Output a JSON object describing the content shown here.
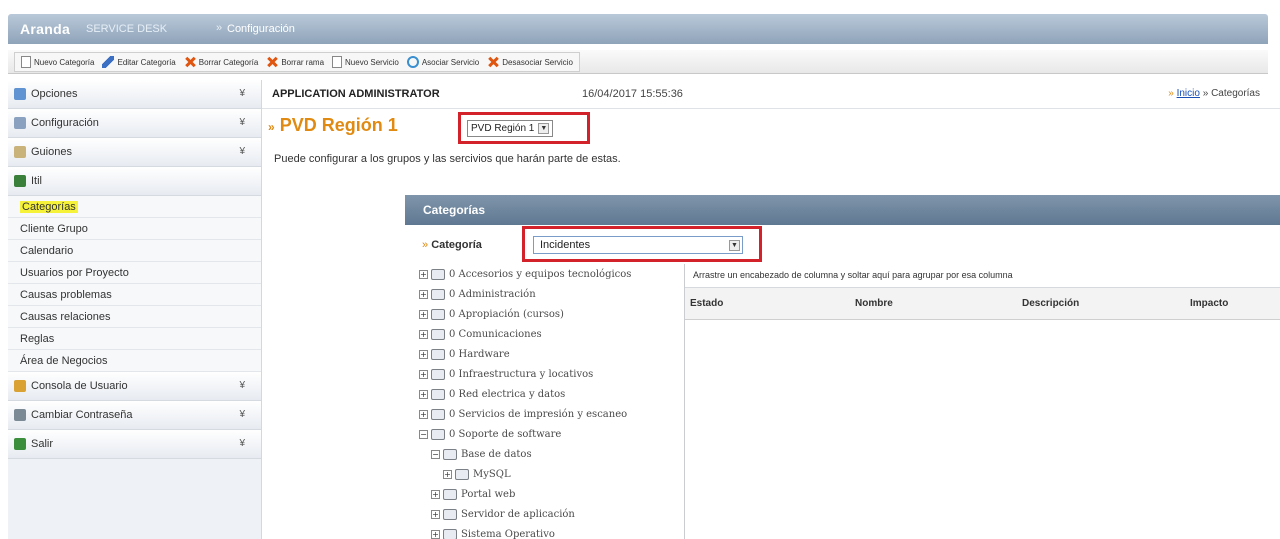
{
  "header": {
    "brand": "Aranda",
    "brand_sub": "SERVICE DESK",
    "separator": "»",
    "section": "Configuración"
  },
  "toolbar": {
    "buttons": [
      {
        "label": "Nuevo Categoría",
        "icon": "document-icon"
      },
      {
        "label": "Editar Categoría",
        "icon": "pencil-icon"
      },
      {
        "label": "Borrar Categoría",
        "icon": "delete-icon"
      },
      {
        "label": "Borrar rama",
        "icon": "delete-icon"
      },
      {
        "label": "Nuevo Servicio",
        "icon": "document-icon"
      },
      {
        "label": "Asociar Servicio",
        "icon": "link-icon"
      },
      {
        "label": "Desasociar Servicio",
        "icon": "delete-icon"
      }
    ]
  },
  "sidebar": {
    "sections_top": [
      {
        "label": "Opciones",
        "chevron": "¥"
      },
      {
        "label": "Configuración",
        "chevron": "¥"
      },
      {
        "label": "Guiones",
        "chevron": "¥"
      },
      {
        "label": "Itil",
        "chevron": ""
      }
    ],
    "items": [
      {
        "label": "Categorías",
        "highlight": true
      },
      {
        "label": "Cliente Grupo"
      },
      {
        "label": "Calendario"
      },
      {
        "label": "Usuarios por Proyecto"
      },
      {
        "label": "Causas problemas"
      },
      {
        "label": "Causas relaciones"
      },
      {
        "label": "Reglas"
      },
      {
        "label": "Área de Negocios"
      }
    ],
    "sections_bottom": [
      {
        "label": "Consola de Usuario",
        "chevron": "¥"
      },
      {
        "label": "Cambiar Contraseña",
        "chevron": "¥"
      },
      {
        "label": "Salir",
        "chevron": "¥"
      }
    ]
  },
  "infobar": {
    "user": "APPLICATION ADMINISTRATOR",
    "datetime": "16/04/2017 15:55:36",
    "crumb_marker": "»",
    "crumb_home": "Inicio",
    "crumb_sep": "»",
    "crumb_current": "Categorías"
  },
  "region": {
    "bullet": "»",
    "title": "PVD Región 1",
    "selected": "PVD Región 1"
  },
  "description": "Puede configurar a los grupos y las sercivios que harán parte de estas.",
  "categories": {
    "header": "Categorías",
    "label_bullet": "»",
    "label": "Categoría",
    "selected": "Incidentes",
    "tree": [
      {
        "label": "0 Accesorios y equipos tecnológicos",
        "level": 0,
        "expander": "+"
      },
      {
        "label": "0 Administración",
        "level": 0,
        "expander": "+"
      },
      {
        "label": "0 Apropiación (cursos)",
        "level": 0,
        "expander": "+"
      },
      {
        "label": "0 Comunicaciones",
        "level": 0,
        "expander": "+"
      },
      {
        "label": "0 Hardware",
        "level": 0,
        "expander": "+"
      },
      {
        "label": "0 Infraestructura y locativos",
        "level": 0,
        "expander": "+"
      },
      {
        "label": "0 Red electrica y datos",
        "level": 0,
        "expander": "+"
      },
      {
        "label": "0 Servicios de impresión y escaneo",
        "level": 0,
        "expander": "+"
      },
      {
        "label": "0 Soporte de software",
        "level": 0,
        "expander": "−"
      },
      {
        "label": "Base de datos",
        "level": 1,
        "expander": "−"
      },
      {
        "label": "MySQL",
        "level": 2,
        "expander": "+"
      },
      {
        "label": "Portal web",
        "level": 1,
        "expander": "+"
      },
      {
        "label": "Servidor de aplicación",
        "level": 1,
        "expander": "+"
      },
      {
        "label": "Sistema Operativo",
        "level": 1,
        "expander": "+"
      }
    ],
    "group_hint": "Arrastre un encabezado de columna y soltar aquí para agrupar por esa columna",
    "columns": [
      "Estado",
      "Nombre",
      "Descripción",
      "Impacto"
    ]
  }
}
